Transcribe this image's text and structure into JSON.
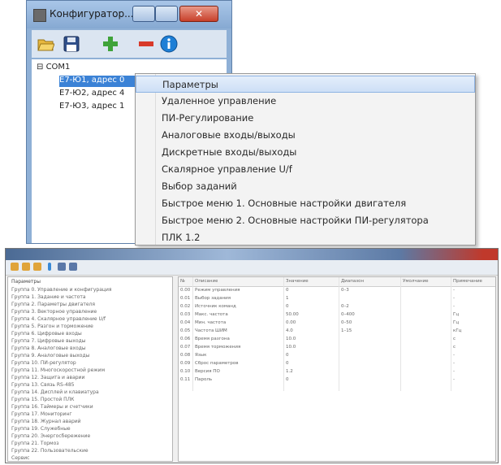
{
  "top_window": {
    "title": "Конфигуратор...",
    "close_glyph": "✕",
    "toolbar": {
      "open_icon": "folder-open-icon",
      "save_icon": "floppy-save-icon",
      "add_icon": "plus-icon",
      "remove_icon": "minus-icon",
      "info_icon": "info-icon"
    },
    "tree": {
      "root": "COM1",
      "devices": [
        "Е7-Ю1, адрес 0",
        "Е7-Ю2, адрес 4",
        "Е7-Ю3, адрес 1"
      ]
    }
  },
  "context_menu": {
    "items": [
      "Параметры",
      "Удаленное управление",
      "ПИ-Регулирование",
      "Аналоговые входы/выходы",
      "Дискретные входы/выходы",
      "Скалярное управление U/f",
      "Выбор заданий",
      "Быстрое меню 1. Основные настройки двигателя",
      "Быстрое меню 2. Основные настройки ПИ-регулятора",
      "ПЛК 1.2"
    ],
    "highlighted_index": 0
  },
  "bottom_window": {
    "left_header": "Параметры",
    "left_items": [
      "Группа 0. Управление и конфигурация",
      "Группа 1. Задание и частота",
      "Группа 2. Параметры двигателя",
      "Группа 3. Векторное управление",
      "Группа 4. Скалярное управление U/f",
      "Группа 5. Разгон и торможение",
      "Группа 6. Цифровые входы",
      "Группа 7. Цифровые выходы",
      "Группа 8. Аналоговые входы",
      "Группа 9. Аналоговые выходы",
      "Группа 10. ПИ-регулятор",
      "Группа 11. Многоскоростной режим",
      "Группа 12. Защита и аварии",
      "Группа 13. Связь RS-485",
      "Группа 14. Дисплей и клавиатура",
      "Группа 15. Простой ПЛК",
      "Группа 16. Таймеры и счетчики",
      "Группа 17. Мониторинг",
      "Группа 18. Журнал аварий",
      "Группа 19. Служебные",
      "Группа 20. Энергосбережение",
      "Группа 21. Тормоз",
      "Группа 22. Пользовательские",
      "Сервис"
    ],
    "columns": [
      "№",
      "Описание",
      "Значение",
      "Диапазон",
      "Умолчание",
      "Примечание"
    ],
    "rows": [
      [
        "0.00",
        "Режим управления",
        "0",
        "0–3",
        "",
        "-"
      ],
      [
        "0.01",
        "Выбор задания",
        "1",
        "",
        "",
        "-"
      ],
      [
        "0.02",
        "Источник команд",
        "0",
        "0–2",
        "",
        "-"
      ],
      [
        "0.03",
        "Макс. частота",
        "50.00",
        "0–400",
        "",
        "Гц"
      ],
      [
        "0.04",
        "Мин. частота",
        "0.00",
        "0–50",
        "",
        "Гц"
      ],
      [
        "0.05",
        "Частота ШИМ",
        "4.0",
        "1–15",
        "",
        "кГц"
      ],
      [
        "0.06",
        "Время разгона",
        "10.0",
        "",
        "",
        "с"
      ],
      [
        "0.07",
        "Время торможения",
        "10.0",
        "",
        "",
        "с"
      ],
      [
        "0.08",
        "Язык",
        "0",
        "",
        "",
        "-"
      ],
      [
        "0.09",
        "Сброс параметров",
        "0",
        "",
        "",
        "-"
      ],
      [
        "0.10",
        "Версия ПО",
        "1.2",
        "",
        "",
        "-"
      ],
      [
        "0.11",
        "Пароль",
        "0",
        "",
        "",
        "-"
      ]
    ]
  }
}
